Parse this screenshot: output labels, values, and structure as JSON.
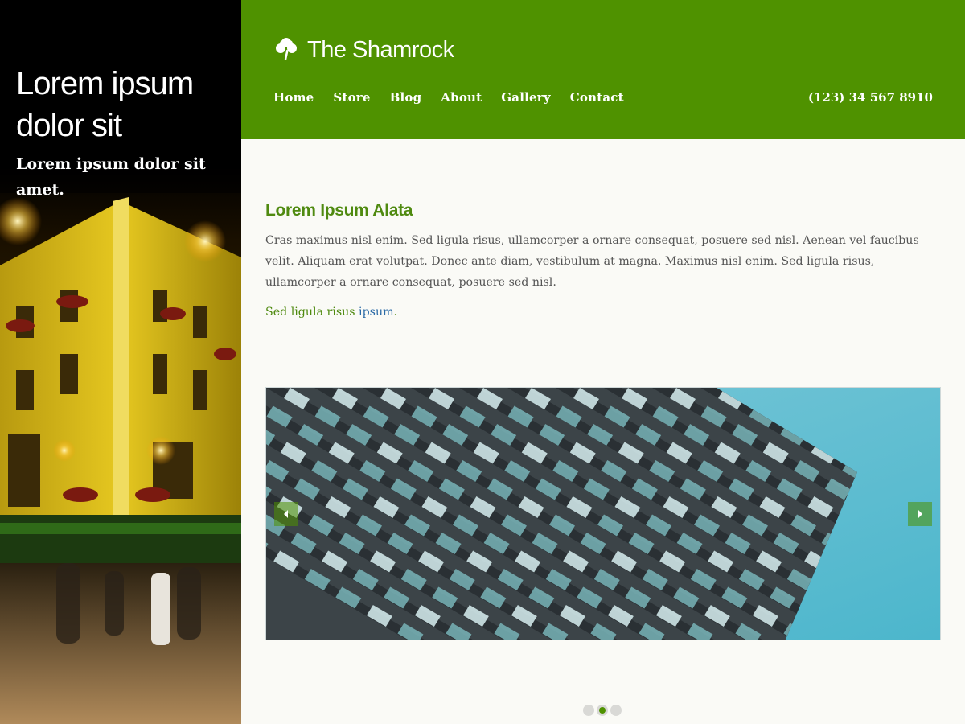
{
  "hero": {
    "title": "Lorem ipsum dolor sit",
    "subtitle": "Lorem ipsum dolor sit amet."
  },
  "header": {
    "brand_icon": "shamrock-icon",
    "brand_name": "The Shamrock",
    "nav": [
      "Home",
      "Store",
      "Blog",
      "About",
      "Gallery",
      "Contact"
    ],
    "phone": "(123) 34 567 8910"
  },
  "content": {
    "heading": "Lorem Ipsum Alata",
    "body": "Cras maximus nisl enim. Sed ligula risus, ullamcorper a ornare consequat, posuere sed nisl. Aenean vel faucibus velit. Aliquam erat volutpat. Donec ante diam, vestibulum at magna. Maximus nisl enim. Sed ligula risus, ullamcorper a ornare consequat, posuere sed nisl.",
    "link_prefix": "Sed ligula risus ",
    "link_text": "ipsum",
    "link_suffix": "."
  },
  "slider": {
    "prev_icon": "arrow-left-icon",
    "next_icon": "arrow-right-icon",
    "dots": 3,
    "active_dot": 2
  },
  "colors": {
    "brand_green": "#4f9200",
    "heading_green": "#4f8a10",
    "link_blue": "#2a6aa6"
  }
}
